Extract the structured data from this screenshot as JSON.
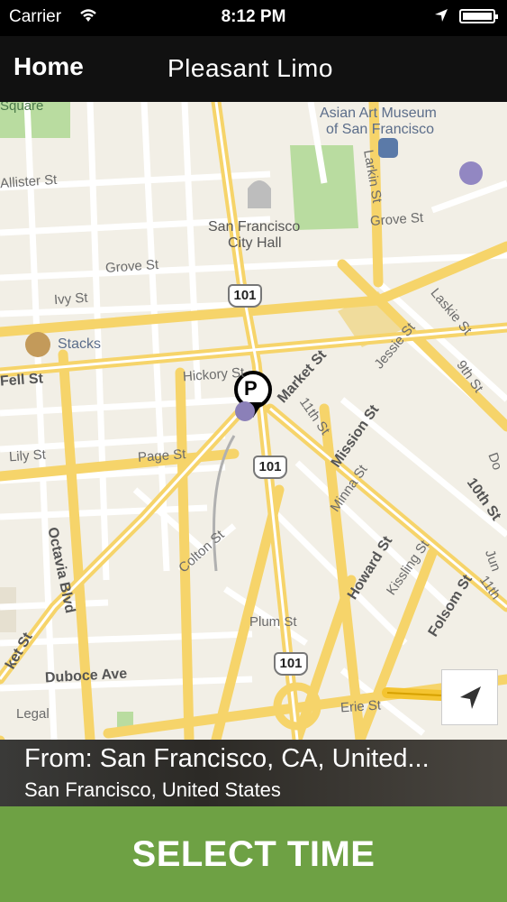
{
  "status_bar": {
    "carrier": "Carrier",
    "time": "8:12 PM"
  },
  "nav": {
    "home_label": "Home",
    "title": "Pleasant Limo"
  },
  "map": {
    "streets": [
      "Allister St",
      "Grove St",
      "Ivy St",
      "Fell St",
      "Hickory St",
      "Page St",
      "Lily St",
      "Octavia Blvd",
      "Colton St",
      "Plum St",
      "Duboce Ave",
      "Legal",
      "Erie St",
      "Market St",
      "11th St",
      "Mission St",
      "Minna St",
      "Howard St",
      "Kissling St",
      "Folsom St",
      "Larkin St",
      "Laskie St",
      "Jessie St",
      "9th St",
      "10th St",
      "Do",
      "Jun",
      "11th",
      "ket St",
      "Larkin"
    ],
    "pois": [
      "Asian Art Museum",
      "of San Francisco",
      "San Francisco",
      "City Hall",
      "Stacks",
      "Square"
    ],
    "highway_shields": [
      "101",
      "101",
      "101"
    ],
    "pin_label": "P"
  },
  "trip": {
    "from_text": "From: San Francisco, CA, United...",
    "sub_text": "San Francisco, United States"
  },
  "action": {
    "select_label": "SELECT TIME"
  },
  "colors": {
    "button_green": "#6ea144",
    "map_bg": "#f2efe6",
    "road_yellow": "#f6d46a",
    "park_green": "#b9dca0"
  }
}
